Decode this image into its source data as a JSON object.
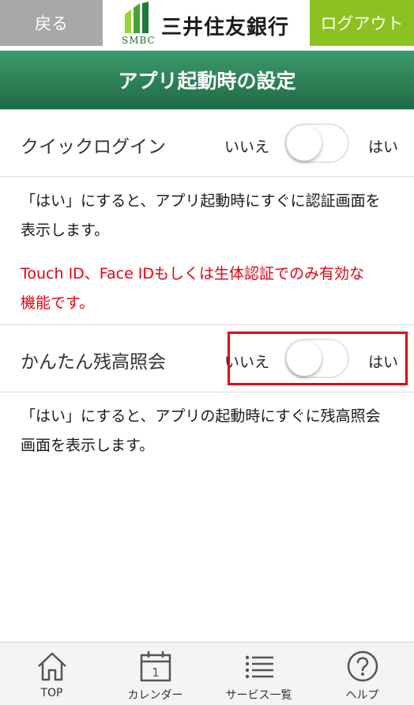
{
  "header": {
    "back_label": "戻る",
    "logout_label": "ログアウト",
    "logo_sub": "SMBC",
    "logo_name": "三井住友銀行"
  },
  "title": "アプリ起動時の設定",
  "settings": [
    {
      "label": "クイックログイン",
      "no_label": "いいえ",
      "yes_label": "はい",
      "enabled": false,
      "description_lines": [
        "「はい」にすると、アプリ起動時にすぐに認証画面を",
        "表示します。"
      ],
      "note_lines": [
        "Touch ID、Face IDもしくは生体認証でのみ有効な",
        "機能です。"
      ]
    },
    {
      "label": "かんたん残高照会",
      "no_label": "いいえ",
      "yes_label": "はい",
      "enabled": false,
      "description_lines": [
        "「はい」にすると、アプリの起動時にすぐに残高照会",
        "画面を表示します。"
      ]
    }
  ],
  "tabbar": {
    "items": [
      {
        "label": "TOP",
        "icon": "home-icon"
      },
      {
        "label": "カレンダー",
        "icon": "calendar-icon"
      },
      {
        "label": "サービス一覧",
        "icon": "list-icon"
      },
      {
        "label": "ヘルプ",
        "icon": "help-icon"
      }
    ],
    "calendar_day": "1"
  },
  "colors": {
    "back_button": "#a8a8a8",
    "logout_button": "#8cc21f",
    "title_bar": "#2b7d55",
    "note_text": "#e60012",
    "highlight": "#e0001a"
  }
}
